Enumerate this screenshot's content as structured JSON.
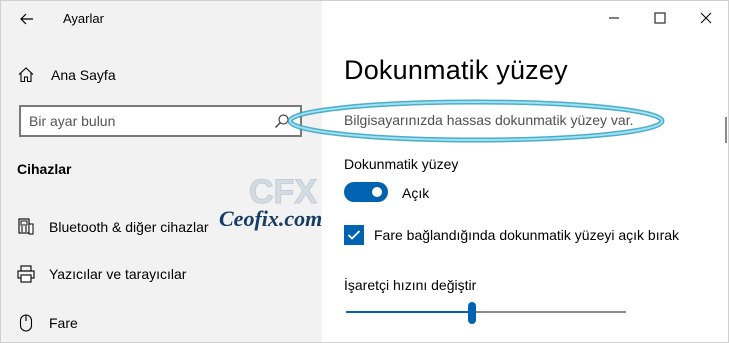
{
  "window": {
    "title": "Ayarlar",
    "controls": [
      "minimize",
      "maximize",
      "close"
    ]
  },
  "sidebar": {
    "home_label": "Ana Sayfa",
    "search_placeholder": "Bir ayar bulun",
    "section_title": "Cihazlar",
    "items": [
      {
        "label": "Bluetooth & diğer cihazlar",
        "icon": "bluetooth-devices-icon"
      },
      {
        "label": "Yazıcılar ve tarayıcılar",
        "icon": "printer-icon"
      },
      {
        "label": "Fare",
        "icon": "mouse-icon"
      }
    ]
  },
  "main": {
    "title": "Dokunmatik yüzey",
    "description": "Bilgisayarınızda hassas dokunmatik yüzey var.",
    "toggle": {
      "label": "Dokunmatik yüzey",
      "state_label": "Açık",
      "on": true
    },
    "checkbox": {
      "label": "Fare bağlandığında dokunmatik yüzeyi açık bırak",
      "checked": true
    },
    "slider": {
      "label": "İşaretçi hızını değiştir",
      "value_fraction": 0.45
    }
  },
  "watermark": {
    "logo_letters": "CFX",
    "text": "Ceofix.com"
  },
  "colors": {
    "accent": "#0063b1",
    "sidebar_bg": "#f2f2f2",
    "highlight": "#3aa7c9"
  }
}
